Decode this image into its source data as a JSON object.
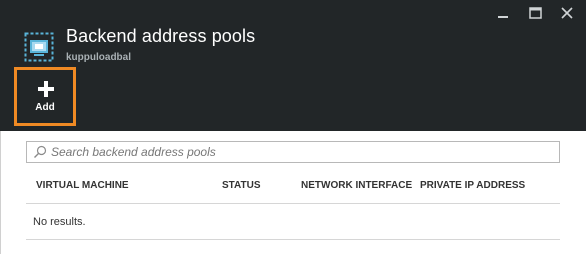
{
  "window": {
    "minimize_icon": "minimize-icon",
    "maximize_icon": "maximize-icon",
    "close_icon": "close-icon"
  },
  "header": {
    "title": "Backend address pools",
    "subtitle": "kuppuloadbal",
    "icon": "load-balancer-pool-icon"
  },
  "toolbar": {
    "add_label": "Add",
    "add_icon": "plus-icon"
  },
  "colors": {
    "header_bg": "#222628",
    "highlight": "#f08a24",
    "icon_blue": "#59b4d9"
  },
  "search": {
    "placeholder": "Search backend address pools",
    "value": ""
  },
  "table": {
    "columns": [
      "VIRTUAL MACHINE",
      "STATUS",
      "NETWORK INTERFACE",
      "PRIVATE IP ADDRESS"
    ],
    "rows": [],
    "empty_message": "No results."
  }
}
